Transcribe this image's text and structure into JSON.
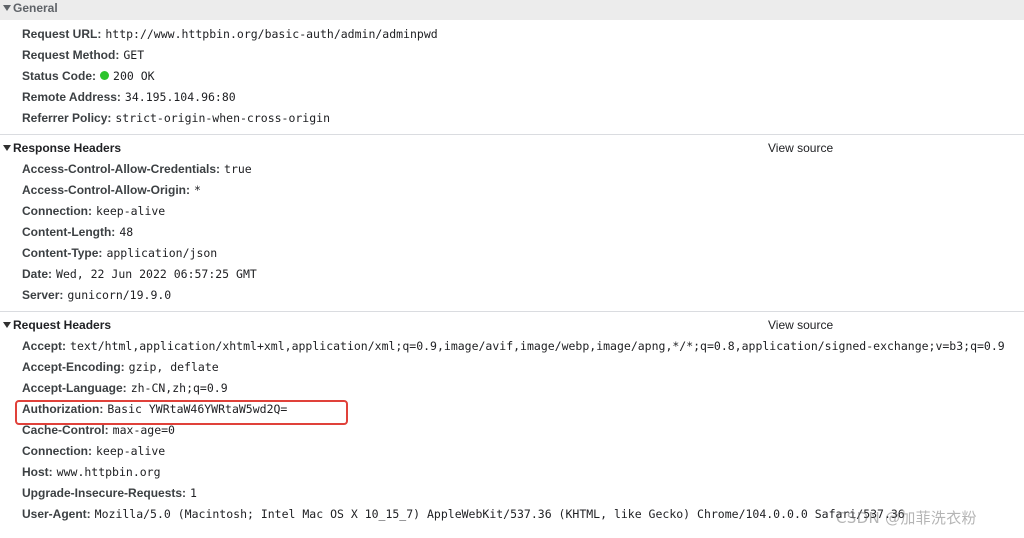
{
  "general": {
    "title": "General",
    "rows": [
      {
        "name": "Request URL:",
        "value": "http://www.httpbin.org/basic-auth/admin/adminpwd"
      },
      {
        "name": "Request Method:",
        "value": "GET"
      },
      {
        "name": "Status Code:",
        "value": "200 OK"
      },
      {
        "name": "Remote Address:",
        "value": "34.195.104.96:80"
      },
      {
        "name": "Referrer Policy:",
        "value": "strict-origin-when-cross-origin"
      }
    ],
    "status_color": "#2dc42d"
  },
  "response_headers": {
    "title": "Response Headers",
    "view_source": "View source",
    "rows": [
      {
        "name": "Access-Control-Allow-Credentials:",
        "value": "true"
      },
      {
        "name": "Access-Control-Allow-Origin:",
        "value": "*"
      },
      {
        "name": "Connection:",
        "value": "keep-alive"
      },
      {
        "name": "Content-Length:",
        "value": "48"
      },
      {
        "name": "Content-Type:",
        "value": "application/json"
      },
      {
        "name": "Date:",
        "value": "Wed, 22 Jun 2022 06:57:25 GMT"
      },
      {
        "name": "Server:",
        "value": "gunicorn/19.9.0"
      }
    ]
  },
  "request_headers": {
    "title": "Request Headers",
    "view_source": "View source",
    "rows": [
      {
        "name": "Accept:",
        "value": "text/html,application/xhtml+xml,application/xml;q=0.9,image/avif,image/webp,image/apng,*/*;q=0.8,application/signed-exchange;v=b3;q=0.9"
      },
      {
        "name": "Accept-Encoding:",
        "value": "gzip, deflate"
      },
      {
        "name": "Accept-Language:",
        "value": "zh-CN,zh;q=0.9"
      },
      {
        "name": "Authorization:",
        "value": "Basic YWRtaW46YWRtaW5wd2Q="
      },
      {
        "name": "Cache-Control:",
        "value": "max-age=0"
      },
      {
        "name": "Connection:",
        "value": "keep-alive"
      },
      {
        "name": "Host:",
        "value": "www.httpbin.org"
      },
      {
        "name": "Upgrade-Insecure-Requests:",
        "value": "1"
      },
      {
        "name": "User-Agent:",
        "value": "Mozilla/5.0 (Macintosh; Intel Mac OS X 10_15_7) AppleWebKit/537.36 (KHTML, like Gecko) Chrome/104.0.0.0 Safari/537.36"
      }
    ]
  },
  "annotation": {
    "highlight_color": "#e0413a"
  },
  "watermark": "CSDN @加菲洗衣粉"
}
